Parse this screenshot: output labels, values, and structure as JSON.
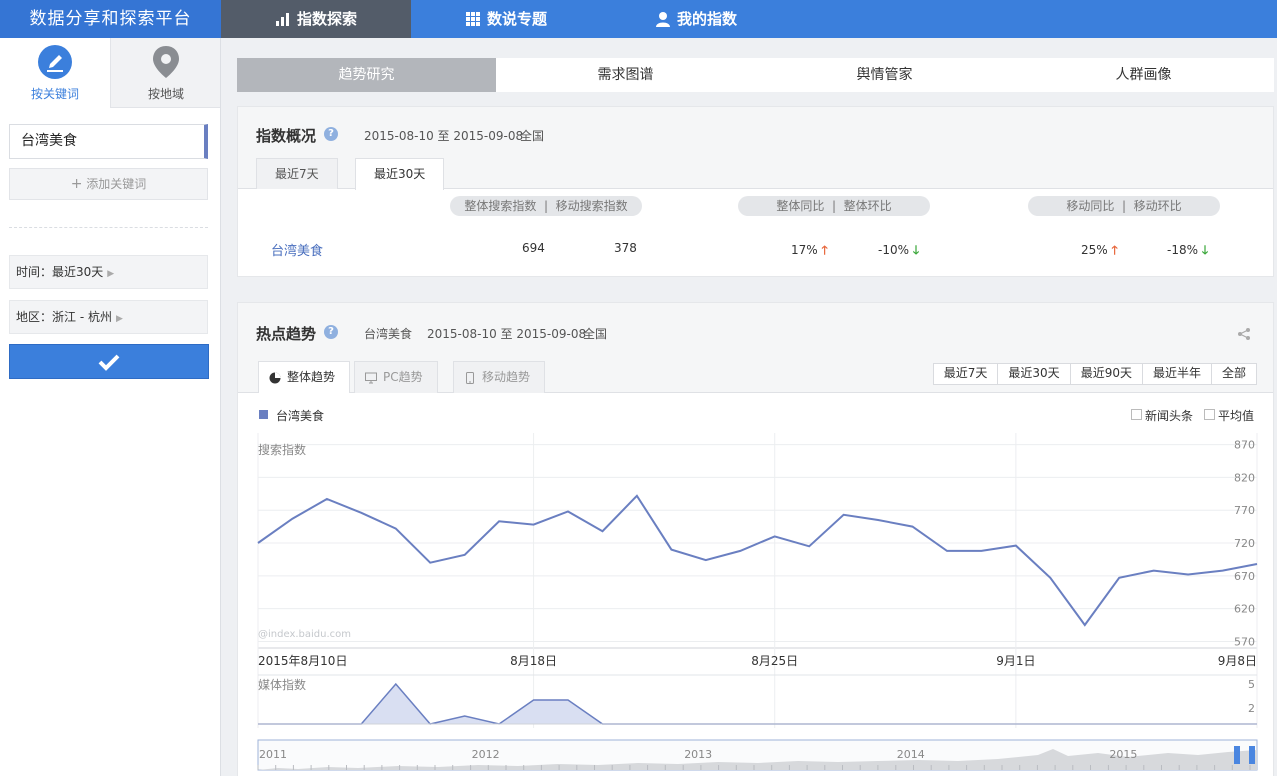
{
  "header": {
    "brand": "数据分享和探索平台",
    "nav": [
      {
        "label": "指数探索",
        "icon": "bar-chart-icon"
      },
      {
        "label": "数说专题",
        "icon": "grid-icon"
      },
      {
        "label": "我的指数",
        "icon": "user-icon"
      }
    ]
  },
  "sidebar": {
    "mode_tabs": [
      {
        "label": "按关键词",
        "icon": "edit-pen-icon"
      },
      {
        "label": "按地域",
        "icon": "map-pin-icon"
      }
    ],
    "keyword": "台湾美食",
    "add_keyword": "添加关键词",
    "filters": [
      {
        "label": "时间：最近30天"
      },
      {
        "label": "地区：浙江 - 杭州"
      }
    ]
  },
  "subnav": {
    "tabs": [
      "趋势研究",
      "需求图谱",
      "舆情管家",
      "人群画像"
    ]
  },
  "overview": {
    "title": "指数概况",
    "date_range": "2015-08-10 至 2015-09-08",
    "region": "全国",
    "range_tabs": [
      "最近7天",
      "最近30天"
    ],
    "headers": {
      "search": [
        "整体搜索指数",
        "移动搜索指数"
      ],
      "overall": [
        "整体同比",
        "整体环比"
      ],
      "mobile": [
        "移动同比",
        "移动环比"
      ]
    },
    "row": {
      "keyword": "台湾美食",
      "overall_search": "694",
      "mobile_search": "378",
      "overall_yoy": "17%",
      "overall_mom": "-10%",
      "mobile_yoy": "25%",
      "mobile_mom": "-18%"
    }
  },
  "trend": {
    "title": "热点趋势",
    "keyword": "台湾美食",
    "date_range": "2015-08-10 至 2015-09-08",
    "region": "全国",
    "tabs": [
      "整体趋势",
      "PC趋势",
      "移动趋势"
    ],
    "periods": [
      "最近7天",
      "最近30天",
      "最近90天",
      "最近半年",
      "全部"
    ],
    "legend": "台湾美食",
    "checkboxes": [
      "新闻头条",
      "平均值"
    ],
    "watermark": "@index.baidu.com"
  },
  "chart_data": [
    {
      "type": "line",
      "ylabel": "搜索指数",
      "series": [
        {
          "name": "台湾美食",
          "values": [
            720,
            757,
            787,
            766,
            742,
            690,
            702,
            753,
            748,
            768,
            738,
            792,
            710,
            694,
            708,
            730,
            715,
            763,
            755,
            745,
            708,
            708,
            716,
            667,
            595,
            667,
            678,
            672,
            678,
            688
          ]
        }
      ],
      "x_tick_labels": [
        "2015年8月10日",
        "8月18日",
        "8月25日",
        "9月1日",
        "9月8日"
      ],
      "x_tick_index": [
        0,
        8,
        15,
        22,
        29
      ],
      "y_ticks": [
        870,
        820,
        770,
        720,
        670,
        620,
        570
      ],
      "ylim": [
        560,
        880
      ],
      "color": "#6a7fc1"
    },
    {
      "type": "area",
      "ylabel": "媒体指数",
      "series": [
        {
          "name": "台湾美食",
          "values": [
            0,
            0,
            0,
            0,
            5,
            0,
            1,
            0,
            3,
            3,
            0,
            0,
            0,
            0,
            0,
            0,
            0,
            0,
            0,
            0,
            0,
            0,
            0,
            0,
            0,
            0,
            0,
            0,
            0,
            0
          ]
        }
      ],
      "y_ticks": [
        5,
        2
      ],
      "ylim": [
        0,
        5
      ],
      "color": "#6a7fc1"
    }
  ],
  "overview_strip": {
    "years": [
      "2011",
      "2012",
      "2013",
      "2014",
      "2015"
    ]
  }
}
